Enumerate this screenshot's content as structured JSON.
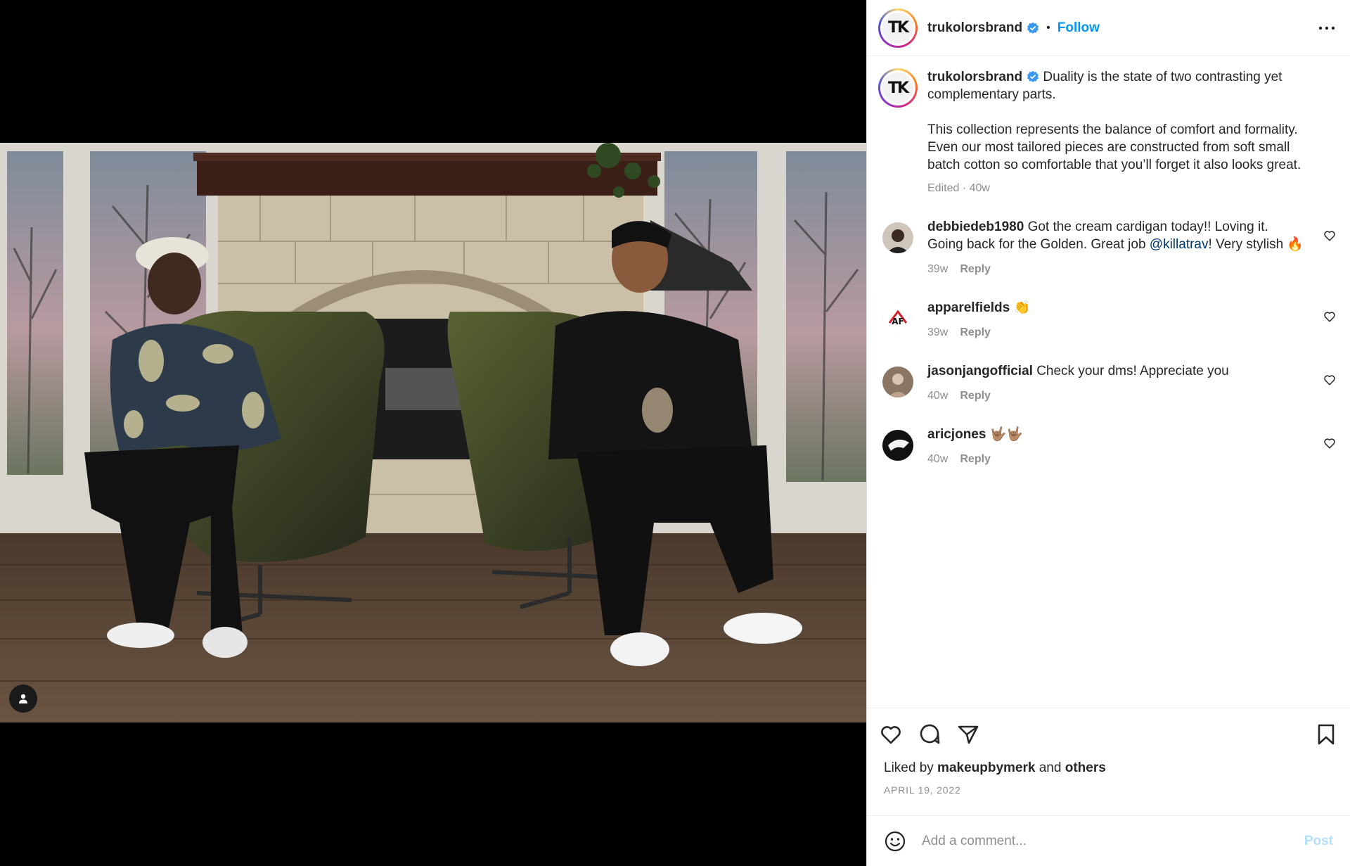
{
  "post": {
    "author": "trukolorsbrand",
    "avatar_text": "TK",
    "follow_label": "Follow",
    "separator": "•"
  },
  "caption": {
    "username": "trukolorsbrand",
    "line1": "Duality is the state of two contrasting yet complementary parts.",
    "line2": "This collection represents the balance of comfort and formality. Even our most tailored pieces are constructed from soft small batch cotton so comfortable that you’ll forget it also looks great.",
    "meta": "Edited · 40w"
  },
  "comments": [
    {
      "username": "debbiedeb1980",
      "text_before": "Got the cream cardigan today!! Loving it. Going back for the Golden. Great job ",
      "mention": "@killatrav",
      "text_after": "! Very stylish 🔥",
      "time": "39w",
      "reply_label": "Reply"
    },
    {
      "username": "apparelfields",
      "text_before": "👏",
      "mention": "",
      "text_after": "",
      "time": "39w",
      "reply_label": "Reply",
      "avatar_text": "AF"
    },
    {
      "username": "jasonjangofficial",
      "text_before": "Check your dms! Appreciate you",
      "mention": "",
      "text_after": "",
      "time": "40w",
      "reply_label": "Reply"
    },
    {
      "username": "aricjones",
      "text_before": "🤟🏽🤟🏽",
      "mention": "",
      "text_after": "",
      "time": "40w",
      "reply_label": "Reply"
    }
  ],
  "likes": {
    "prefix": "Liked by ",
    "user": "makeupbymerk",
    "joiner": " and ",
    "others": "others"
  },
  "date": "APRIL 19, 2022",
  "comment_box": {
    "placeholder": "Add a comment...",
    "post_label": "Post"
  },
  "colors": {
    "accent": "#0095f6",
    "verified": "#3897f0",
    "post_disabled": "#b2dffc"
  }
}
